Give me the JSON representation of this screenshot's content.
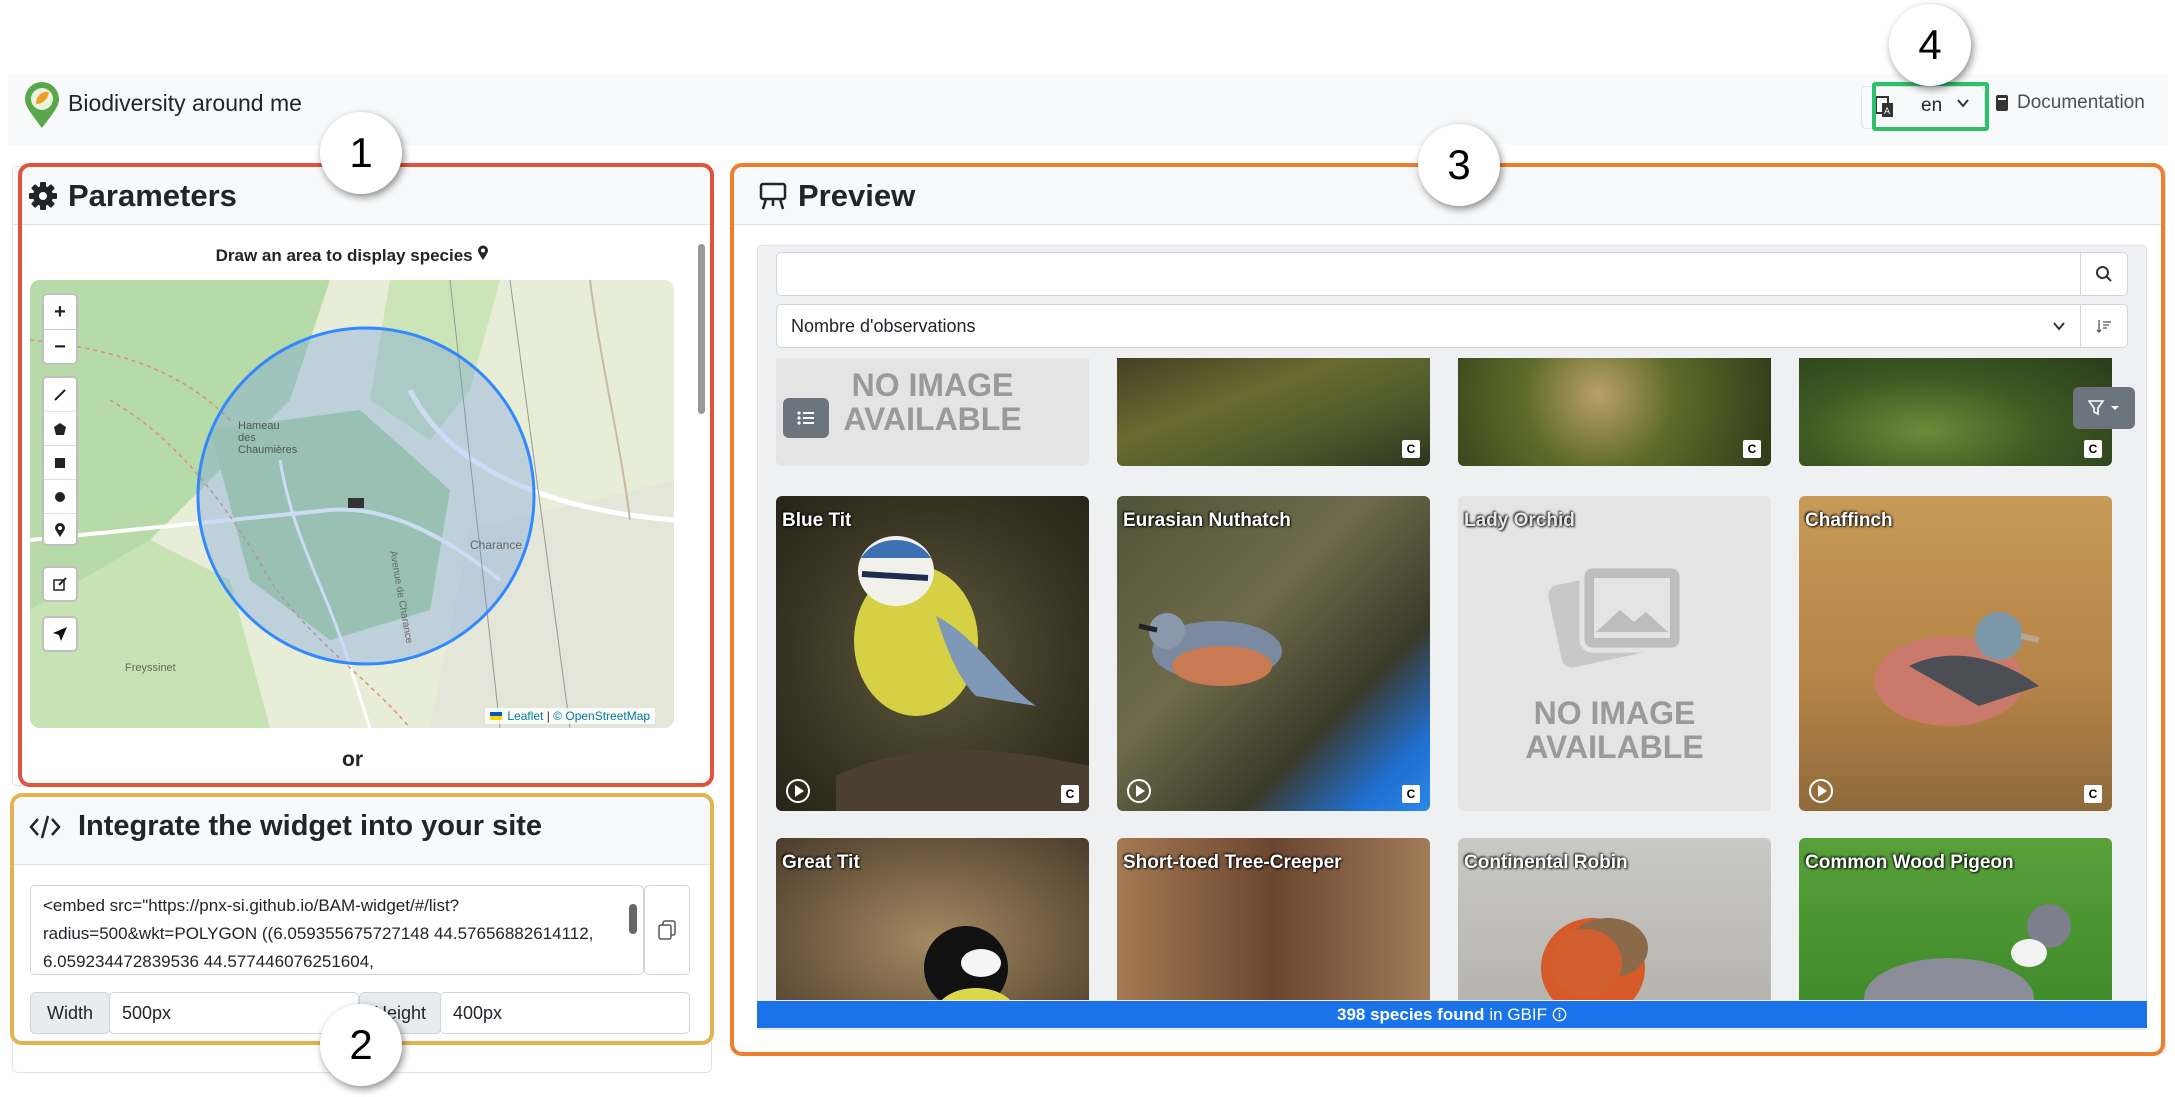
{
  "app": {
    "title": "Biodiversity around me"
  },
  "header": {
    "language": "en",
    "documentation_label": "Documentation"
  },
  "parameters": {
    "title": "Parameters",
    "draw_label": "Draw an area to display species",
    "map": {
      "controls": [
        "zoom-in",
        "zoom-out",
        "draw-polyline",
        "draw-polygon",
        "draw-rectangle",
        "draw-circle",
        "draw-marker",
        "edit-layers",
        "locate"
      ],
      "zoom_in_label": "+",
      "zoom_out_label": "−",
      "place_labels": [
        "Hameau des Chaumières",
        "Charance",
        "Freyssinet",
        "Avenue de Charance"
      ],
      "attribution_leaflet": "Leaflet",
      "attribution_sep": "|",
      "attribution_osm": "© OpenStreetMap",
      "circle_color": "#3388ff"
    },
    "or_label": "or"
  },
  "integrate": {
    "title": "Integrate the widget into your site",
    "embed_code": "<embed src=\"https://pnx-si.github.io/BAM-widget/#/list?radius=500&wkt=POLYGON ((6.059355675727148 44.57656882614112, 6.059234472839536 44.577446076251604,",
    "width_label": "Width",
    "width_value": "500px",
    "height_label": "Height",
    "height_value": "400px"
  },
  "preview": {
    "title": "Preview",
    "search_placeholder": "",
    "sort_value": "Nombre d'observations",
    "no_image_text": "NO IMAGE AVAILABLE",
    "species": [
      {
        "name": "",
        "has_image": false
      },
      {
        "name": "",
        "has_image": true
      },
      {
        "name": "",
        "has_image": true
      },
      {
        "name": "",
        "has_image": true
      },
      {
        "name": "Blue Tit",
        "has_image": true
      },
      {
        "name": "Eurasian Nuthatch",
        "has_image": true
      },
      {
        "name": "Lady Orchid",
        "has_image": false
      },
      {
        "name": "Chaffinch",
        "has_image": true
      },
      {
        "name": "Great Tit",
        "has_image": true
      },
      {
        "name": "Short-toed Tree-Creeper",
        "has_image": true
      },
      {
        "name": "Continental Robin",
        "has_image": true
      },
      {
        "name": "Common Wood Pigeon",
        "has_image": true
      }
    ],
    "status": {
      "count_text": "398 species found",
      "source_text": "in GBIF",
      "info_icon": "info-circle-icon"
    },
    "accent": "#1a73e8"
  },
  "annotations": {
    "badge1": "1",
    "badge2": "2",
    "badge3": "3",
    "badge4": "4",
    "colors": {
      "frame1": "#e0533e",
      "frame2": "#e3b352",
      "frame3": "#ec7e2d",
      "frame4": "#2fc16a"
    }
  }
}
